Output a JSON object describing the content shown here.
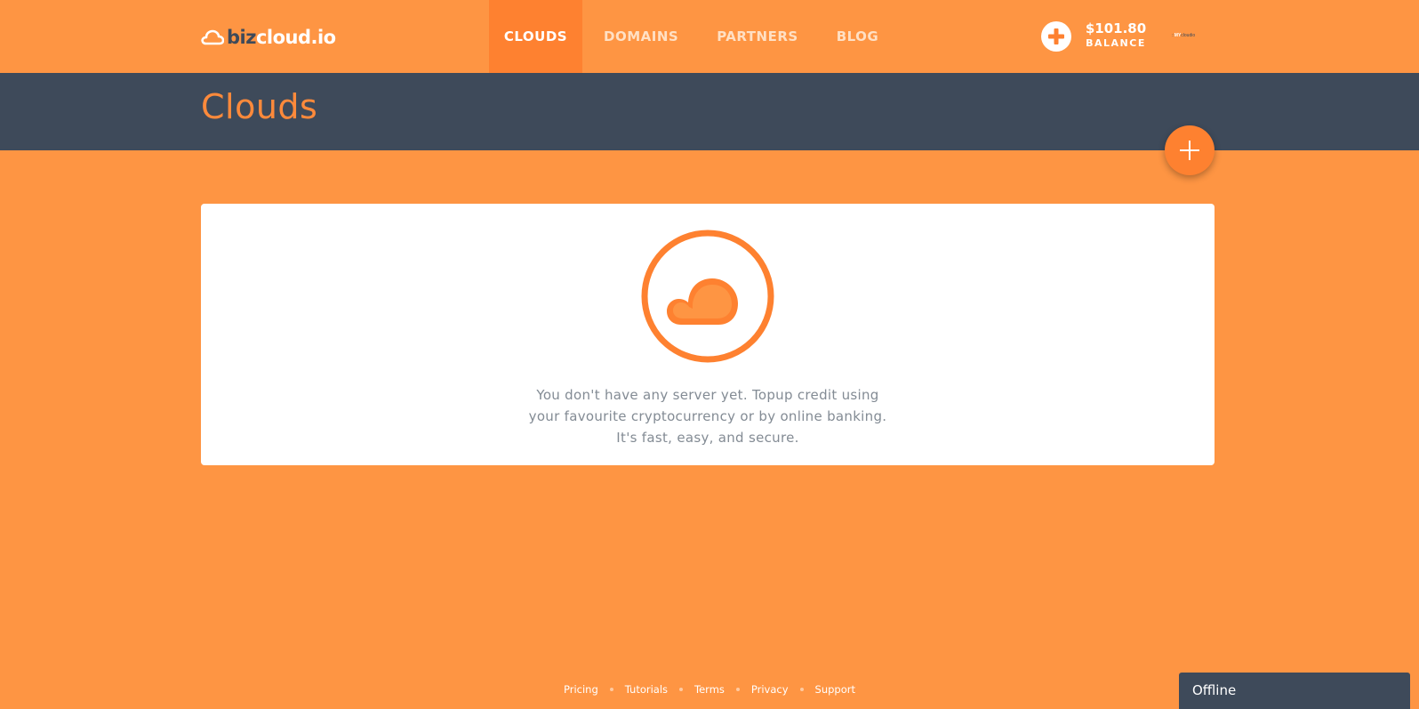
{
  "header": {
    "logo": {
      "part1": "biz",
      "part2": "cloud.io"
    },
    "nav": [
      {
        "label": "CLOUDS",
        "active": true
      },
      {
        "label": "DOMAINS",
        "active": false
      },
      {
        "label": "PARTNERS",
        "active": false
      },
      {
        "label": "BLOG",
        "active": false
      }
    ],
    "balance": {
      "amount": "$101.80",
      "label": "BALANCE"
    },
    "avatar": {
      "prefix": "::",
      "highlight": "MY",
      "rest": "cloudio"
    }
  },
  "page": {
    "title": "Clouds"
  },
  "empty_state": {
    "lines": [
      "You don't have any server yet. Topup credit using",
      "your favourite cryptocurrency or by online banking.",
      "It's fast, easy, and secure."
    ]
  },
  "footer": {
    "links": [
      "Pricing",
      "Tutorials",
      "Terms",
      "Privacy",
      "Support"
    ]
  },
  "chat": {
    "status": "Offline"
  },
  "colors": {
    "primary": "#fe9543",
    "accent": "#fe8130",
    "dark": "#3e4a5a",
    "text_muted": "#838b94"
  }
}
